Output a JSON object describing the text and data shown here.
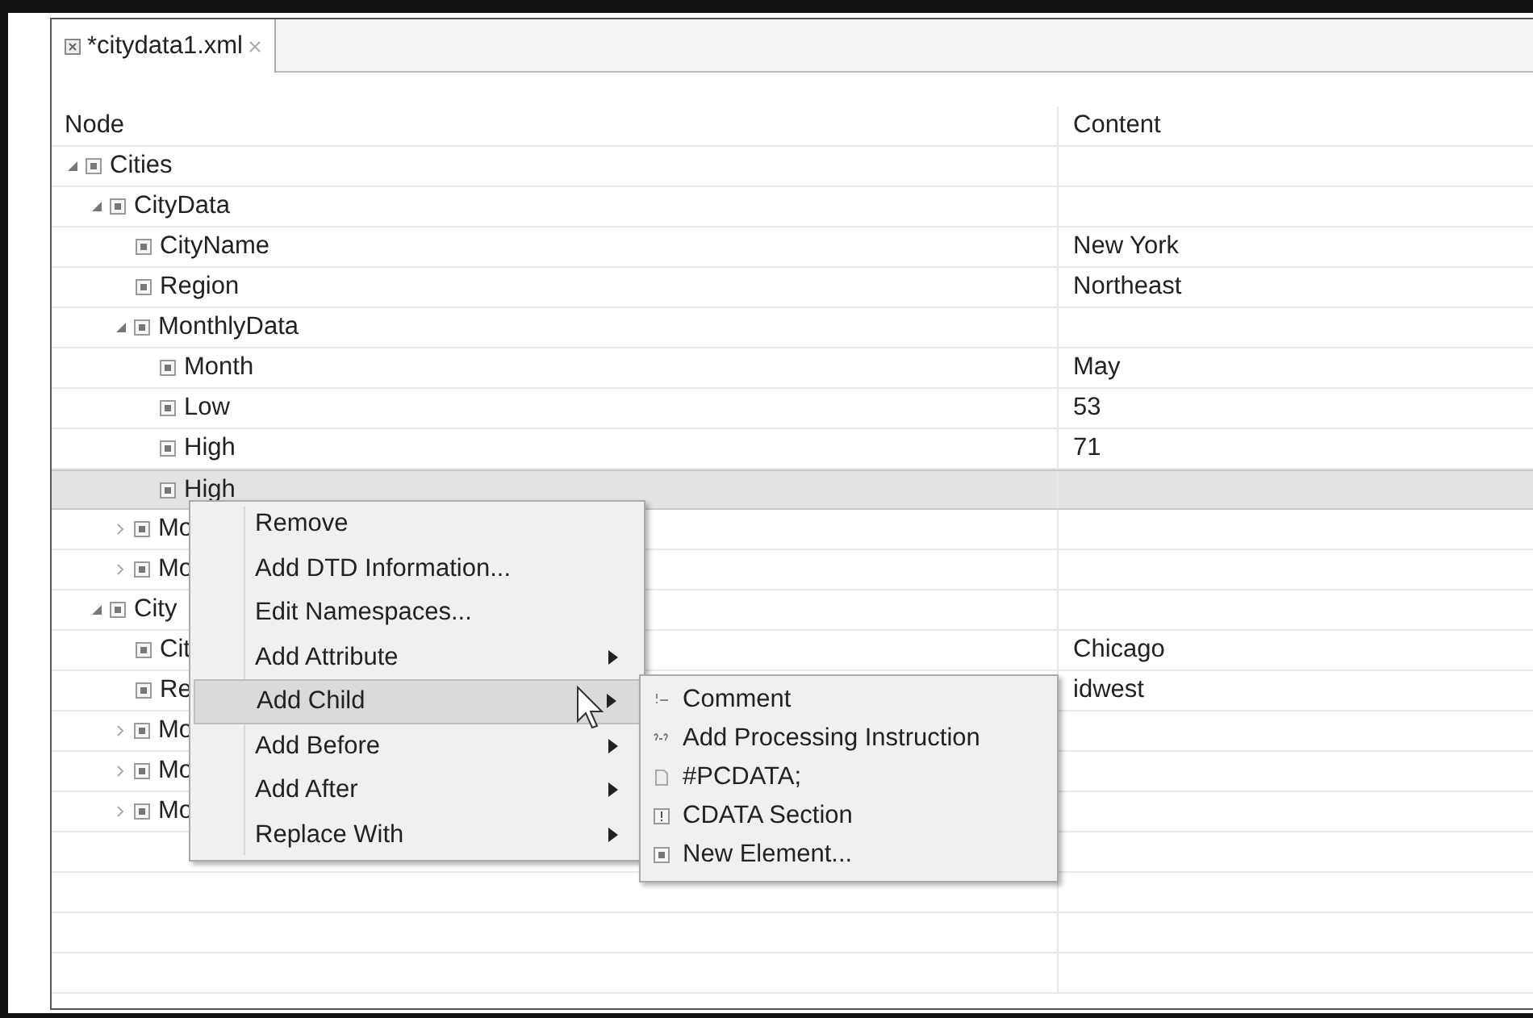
{
  "tab": {
    "label": "*citydata1.xml"
  },
  "columns": [
    "Node",
    "Content"
  ],
  "tree": [
    {
      "name": "Cities",
      "expanded": true,
      "selected": false,
      "children": [
        {
          "name": "CityData",
          "expanded": true,
          "selected": false,
          "children": [
            {
              "name": "CityName",
              "content": "New York",
              "selected": false
            },
            {
              "name": "Region",
              "content": "Northeast",
              "selected": false
            },
            {
              "name": "MonthlyData",
              "expanded": true,
              "selected": false,
              "children": [
                {
                  "name": "Month",
                  "content": "May",
                  "selected": false
                },
                {
                  "name": "Low",
                  "content": "53",
                  "selected": false
                },
                {
                  "name": "High",
                  "content": "71",
                  "selected": false
                },
                {
                  "name": "High",
                  "selected": true
                }
              ]
            },
            {
              "name": "Mo",
              "expanded": false,
              "selected": false
            },
            {
              "name": "Mo",
              "expanded": false,
              "selected": false
            }
          ]
        },
        {
          "name": "City",
          "expanded": true,
          "selected": false,
          "children": [
            {
              "name": "Cit",
              "content": "Chicago",
              "selected": false
            },
            {
              "name": "Re",
              "content": "idwest",
              "selected": false
            },
            {
              "name": "Mo",
              "expanded": false,
              "selected": false
            },
            {
              "name": "Mo",
              "expanded": false,
              "selected": false
            },
            {
              "name": "Mo",
              "expanded": false,
              "selected": false
            }
          ]
        }
      ]
    }
  ],
  "context_menu": [
    {
      "label": "Remove",
      "submenu": false,
      "selected": false
    },
    {
      "label": "Add DTD Information...",
      "submenu": false,
      "selected": false
    },
    {
      "label": "Edit Namespaces...",
      "submenu": false,
      "selected": false
    },
    {
      "label": "Add Attribute",
      "submenu": true,
      "selected": false
    },
    {
      "label": "Add Child",
      "submenu": true,
      "selected": true
    },
    {
      "label": "Add Before",
      "submenu": true,
      "selected": false
    },
    {
      "label": "Add After",
      "submenu": true,
      "selected": false
    },
    {
      "label": "Replace With",
      "submenu": true,
      "selected": false
    }
  ],
  "submenu": [
    {
      "label": "Comment",
      "kind": "comment"
    },
    {
      "label": "Add Processing Instruction",
      "kind": "instruction"
    },
    {
      "label": "#PCDATA;",
      "kind": "pcdata"
    },
    {
      "label": "CDATA Section",
      "kind": "cdata"
    },
    {
      "label": "New Element...",
      "kind": "element"
    }
  ]
}
